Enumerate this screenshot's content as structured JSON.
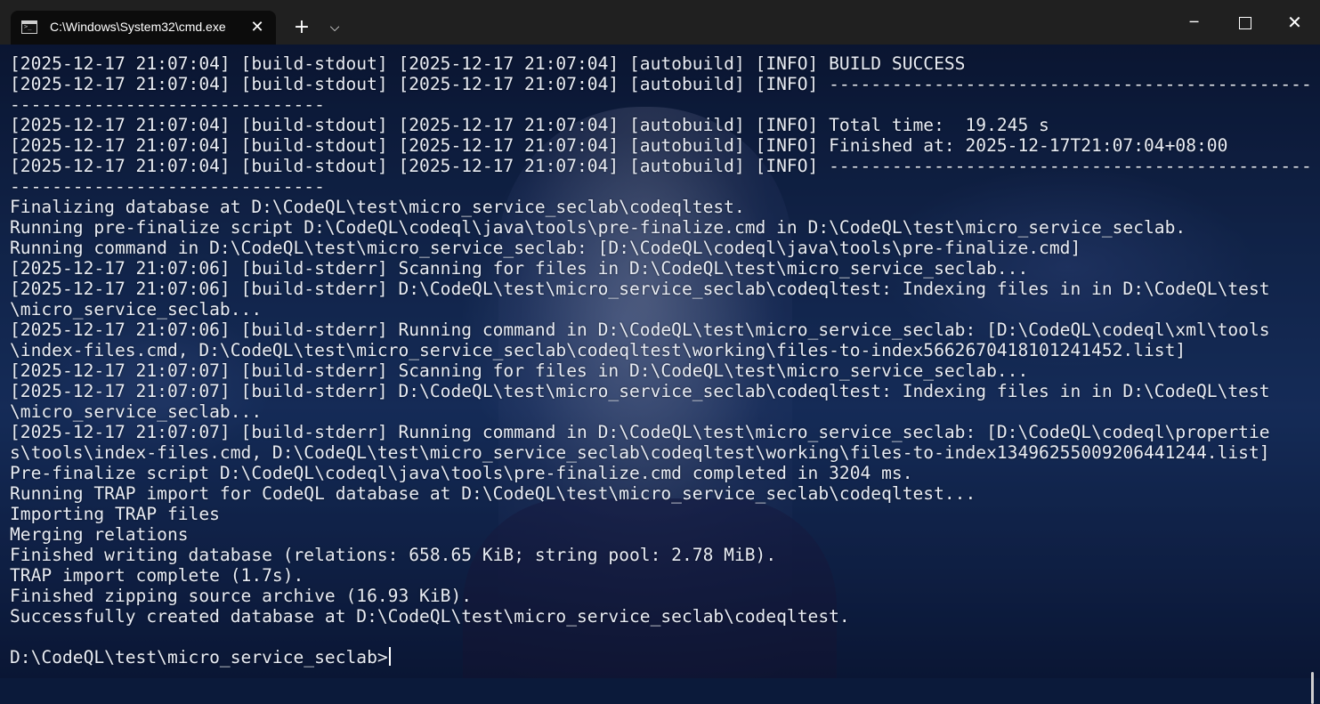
{
  "window": {
    "tab_title": "C:\\Windows\\System32\\cmd.exe",
    "tab_icon": "terminal-icon",
    "close_tab_glyph": "✕",
    "new_tab_glyph": "+",
    "dropdown_glyph": "⌵",
    "minimize_glyph": "─",
    "close_glyph": "✕"
  },
  "terminal": {
    "lines": [
      "[2025-12-17 21:07:04] [build-stdout] [2025-12-17 21:07:04] [autobuild] [INFO] BUILD SUCCESS",
      "[2025-12-17 21:07:04] [build-stdout] [2025-12-17 21:07:04] [autobuild] [INFO] -------------------------------------------------------",
      "------------------------------",
      "[2025-12-17 21:07:04] [build-stdout] [2025-12-17 21:07:04] [autobuild] [INFO] Total time:  19.245 s",
      "[2025-12-17 21:07:04] [build-stdout] [2025-12-17 21:07:04] [autobuild] [INFO] Finished at: 2025-12-17T21:07:04+08:00",
      "[2025-12-17 21:07:04] [build-stdout] [2025-12-17 21:07:04] [autobuild] [INFO] -------------------------------------------------------",
      "------------------------------",
      "Finalizing database at D:\\CodeQL\\test\\micro_service_seclab\\codeqltest.",
      "Running pre-finalize script D:\\CodeQL\\codeql\\java\\tools\\pre-finalize.cmd in D:\\CodeQL\\test\\micro_service_seclab.",
      "Running command in D:\\CodeQL\\test\\micro_service_seclab: [D:\\CodeQL\\codeql\\java\\tools\\pre-finalize.cmd]",
      "[2025-12-17 21:07:06] [build-stderr] Scanning for files in D:\\CodeQL\\test\\micro_service_seclab...",
      "[2025-12-17 21:07:06] [build-stderr] D:\\CodeQL\\test\\micro_service_seclab\\codeqltest: Indexing files in in D:\\CodeQL\\test",
      "\\micro_service_seclab...",
      "[2025-12-17 21:07:06] [build-stderr] Running command in D:\\CodeQL\\test\\micro_service_seclab: [D:\\CodeQL\\codeql\\xml\\tools",
      "\\index-files.cmd, D:\\CodeQL\\test\\micro_service_seclab\\codeqltest\\working\\files-to-index5662670418101241452.list]",
      "[2025-12-17 21:07:07] [build-stderr] Scanning for files in D:\\CodeQL\\test\\micro_service_seclab...",
      "[2025-12-17 21:07:07] [build-stderr] D:\\CodeQL\\test\\micro_service_seclab\\codeqltest: Indexing files in in D:\\CodeQL\\test",
      "\\micro_service_seclab...",
      "[2025-12-17 21:07:07] [build-stderr] Running command in D:\\CodeQL\\test\\micro_service_seclab: [D:\\CodeQL\\codeql\\propertie",
      "s\\tools\\index-files.cmd, D:\\CodeQL\\test\\micro_service_seclab\\codeqltest\\working\\files-to-index1349625500920644124​4.list]",
      "Pre-finalize script D:\\CodeQL\\codeql\\java\\tools\\pre-finalize.cmd completed in 3204 ms.",
      "Running TRAP import for CodeQL database at D:\\CodeQL\\test\\micro_service_seclab\\codeqltest...",
      "Importing TRAP files",
      "Merging relations",
      "Finished writing database (relations: 658.65 KiB; string pool: 2.78 MiB).",
      "TRAP import complete (1.7s).",
      "Finished zipping source archive (16.93 KiB).",
      "Successfully created database at D:\\CodeQL\\test\\micro_service_seclab\\codeqltest.",
      ""
    ],
    "prompt": "D:\\CodeQL\\test\\micro_service_seclab>"
  }
}
